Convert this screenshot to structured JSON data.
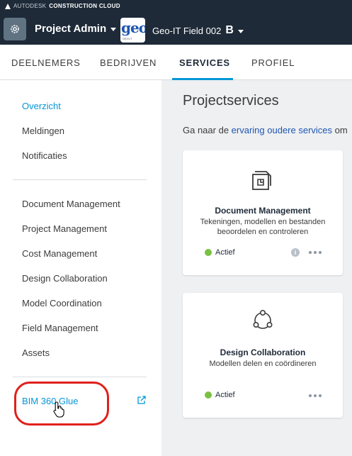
{
  "header": {
    "brand_prefix": "AUTODESK",
    "brand_name": "CONSTRUCTION CLOUD",
    "module_label": "Project Admin",
    "project_logo_text": "geo",
    "project_logo_subtext": "GEO-IT",
    "project_name": "Geo-IT Field 002",
    "project_mark": "B"
  },
  "tabs": [
    {
      "label": "DEELNEMERS",
      "active": false
    },
    {
      "label": "BEDRIJVEN",
      "active": false
    },
    {
      "label": "SERVICES",
      "active": true
    },
    {
      "label": "PROFIEL",
      "active": false
    }
  ],
  "sidebar": {
    "top_items": [
      "Overzicht",
      "Meldingen",
      "Notificaties"
    ],
    "service_items": [
      "Document Management",
      "Project Management",
      "Cost Management",
      "Design Collaboration",
      "Model Coordination",
      "Field Management",
      "Assets"
    ],
    "external_item": "BIM 360 Glue"
  },
  "main": {
    "title": "Projectservices",
    "subtitle_prefix": "Ga naar de",
    "subtitle_link": "ervaring oudere services",
    "subtitle_suffix": "om",
    "cards": [
      {
        "title": "Document Management",
        "description": "Tekeningen, modellen en bestanden beoordelen en controleren",
        "status": "Actief",
        "icon": "document-icon"
      },
      {
        "title": "Design Collaboration",
        "description": "Modellen delen en coördineren",
        "status": "Actief",
        "icon": "network-icon"
      }
    ]
  },
  "colors": {
    "header_bg": "#1e2a38",
    "accent": "#0696d7",
    "status_active": "#7ac143",
    "annotation": "#e0201c"
  }
}
